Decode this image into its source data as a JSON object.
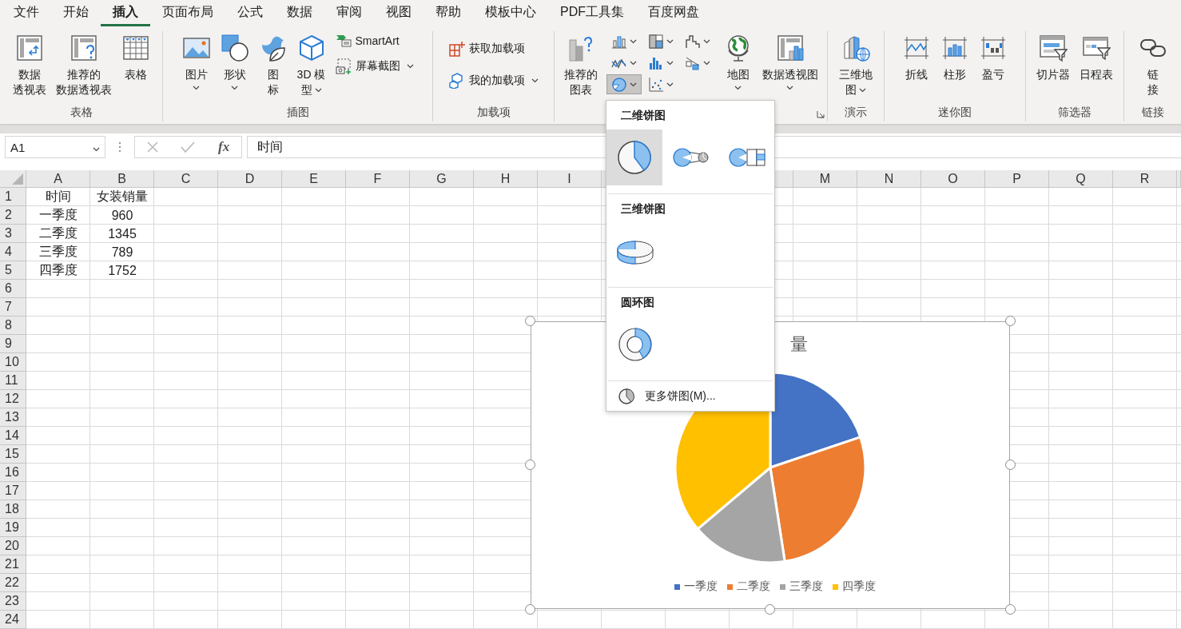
{
  "menu_tabs": [
    {
      "label": "文件",
      "selected": false
    },
    {
      "label": "开始",
      "selected": false
    },
    {
      "label": "插入",
      "selected": true
    },
    {
      "label": "页面布局",
      "selected": false
    },
    {
      "label": "公式",
      "selected": false
    },
    {
      "label": "数据",
      "selected": false
    },
    {
      "label": "审阅",
      "selected": false
    },
    {
      "label": "视图",
      "selected": false
    },
    {
      "label": "帮助",
      "selected": false
    },
    {
      "label": "模板中心",
      "selected": false
    },
    {
      "label": "PDF工具集",
      "selected": false
    },
    {
      "label": "百度网盘",
      "selected": false
    }
  ],
  "ribbon_groups": [
    {
      "label": "表格",
      "items": [
        {
          "kind": "large",
          "lines": [
            "数据",
            "透视表"
          ],
          "dropdown": false
        },
        {
          "kind": "large",
          "lines": [
            "推荐的",
            "数据透视表"
          ],
          "dropdown": false
        },
        {
          "kind": "large",
          "lines": [
            "表格"
          ],
          "dropdown": false
        }
      ]
    },
    {
      "label": "插图",
      "items": [
        {
          "kind": "large",
          "lines": [
            "图片"
          ],
          "dropdown": true
        },
        {
          "kind": "large",
          "lines": [
            "形状"
          ],
          "dropdown": true
        },
        {
          "kind": "large",
          "lines": [
            "图",
            "标"
          ],
          "dropdown": false
        },
        {
          "kind": "large",
          "lines": [
            "3D 模",
            "型"
          ],
          "dropdown": true
        },
        {
          "kind": "small_stack",
          "buttons": [
            {
              "label": "SmartArt",
              "dropdown": false
            },
            {
              "label": "屏幕截图",
              "dropdown": true
            }
          ]
        }
      ]
    },
    {
      "label": "加载项",
      "items": [
        {
          "kind": "small_stack",
          "buttons": [
            {
              "label": "获取加载项",
              "dropdown": false
            },
            {
              "label": "我的加载项",
              "dropdown": true
            }
          ]
        }
      ]
    },
    {
      "launcher": true,
      "items": [
        {
          "kind": "large",
          "lines": [
            "推荐的",
            "图表"
          ],
          "dropdown": false
        },
        {
          "kind": "chart_grid",
          "buttons": [
            {
              "selected": false
            },
            {
              "selected": false
            },
            {
              "selected": false
            },
            {
              "selected": false
            },
            {
              "selected": false
            },
            {
              "selected": false
            },
            {
              "selected": true
            },
            {
              "selected": false
            }
          ]
        },
        {
          "kind": "large",
          "lines": [
            "地图"
          ],
          "dropdown": true
        },
        {
          "kind": "large",
          "lines": [
            "数据透视图"
          ],
          "dropdown": true
        }
      ]
    },
    {
      "label": "演示",
      "items": [
        {
          "kind": "large",
          "lines": [
            "三维地",
            "图"
          ],
          "dropdown": true
        }
      ]
    },
    {
      "label": "迷你图",
      "items": [
        {
          "kind": "large",
          "lines": [
            "折线"
          ],
          "dropdown": false
        },
        {
          "kind": "large",
          "lines": [
            "柱形"
          ],
          "dropdown": false
        },
        {
          "kind": "large",
          "lines": [
            "盈亏"
          ],
          "dropdown": false
        }
      ]
    },
    {
      "label": "筛选器",
      "items": [
        {
          "kind": "large",
          "lines": [
            "切片器"
          ],
          "dropdown": false
        },
        {
          "kind": "large",
          "lines": [
            "日程表"
          ],
          "dropdown": false
        }
      ]
    },
    {
      "label": "链接",
      "items": [
        {
          "kind": "large",
          "lines": [
            "链",
            "接"
          ],
          "dropdown": false
        }
      ]
    }
  ],
  "name_box": "A1",
  "function_button": "fx",
  "formula": "时间",
  "columns_left": [
    "A",
    "B",
    "C",
    "D",
    "E",
    "F",
    "G",
    "H",
    "I"
  ],
  "columns_right": [
    "M",
    "N",
    "O",
    "P",
    "Q",
    "R"
  ],
  "rows": [
    {
      "header": "1",
      "cells": [
        "时间",
        "女装销量"
      ]
    },
    {
      "header": "2",
      "cells": [
        "一季度",
        "960"
      ]
    },
    {
      "header": "3",
      "cells": [
        "二季度",
        "1345"
      ]
    },
    {
      "header": "4",
      "cells": [
        "三季度",
        "789"
      ]
    },
    {
      "header": "5",
      "cells": [
        "四季度",
        "1752"
      ]
    },
    {
      "header": "6"
    },
    {
      "header": "7"
    },
    {
      "header": "8"
    },
    {
      "header": "9"
    },
    {
      "header": "10"
    },
    {
      "header": "11"
    },
    {
      "header": "12"
    },
    {
      "header": "13"
    },
    {
      "header": "14"
    },
    {
      "header": "15"
    },
    {
      "header": "16"
    },
    {
      "header": "17"
    },
    {
      "header": "18"
    },
    {
      "header": "19"
    },
    {
      "header": "20"
    },
    {
      "header": "21"
    },
    {
      "header": "22"
    },
    {
      "header": "23"
    },
    {
      "header": "24"
    }
  ],
  "chart": {
    "title": "量",
    "chart_data": {
      "type": "pie",
      "categories": [
        "一季度",
        "二季度",
        "三季度",
        "四季度"
      ],
      "series": [
        {
          "values": [
            19.81,
            27.75,
            16.28,
            36.16
          ]
        }
      ],
      "legend": "bottom"
    }
  },
  "pie_menu": {
    "sections": [
      {
        "title": "二维饼图",
        "options": [
          {
            "selected": true
          },
          {
            "selected": false
          },
          {
            "selected": false
          }
        ]
      },
      {
        "title": "三维饼图",
        "options": [
          {
            "selected": false
          }
        ]
      },
      {
        "title": "圆环图",
        "options": [
          {
            "selected": false
          }
        ]
      }
    ],
    "more": "更多饼图(M)..."
  }
}
